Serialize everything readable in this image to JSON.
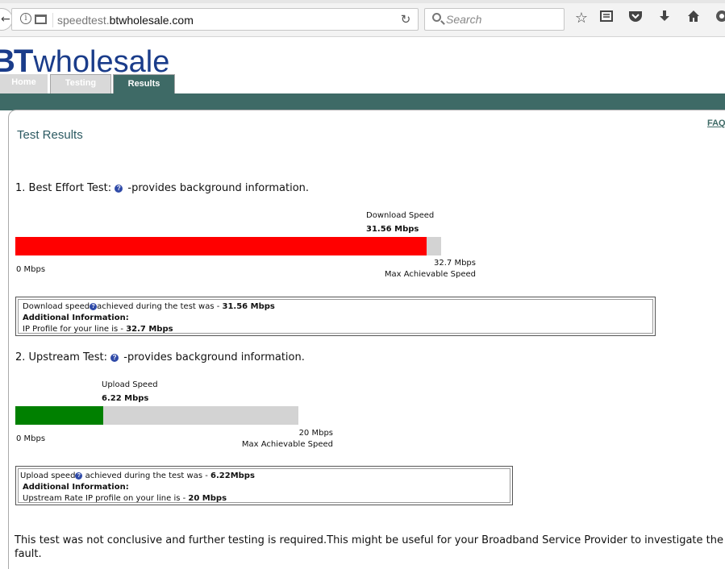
{
  "browser": {
    "url_prefix": "speedtest.",
    "url_domain": "btwholesale.com",
    "search_placeholder": "Search",
    "icons": [
      "back-icon",
      "info-icon",
      "page-icon",
      "reload-icon",
      "search-icon",
      "star-icon",
      "reading-list-icon",
      "pocket-icon",
      "download-icon",
      "home-icon",
      "addon-icon"
    ]
  },
  "header": {
    "logo_bt": "BT",
    "logo_wholesale": "wholesale",
    "tabs": [
      "Home",
      "Testing",
      "Results"
    ],
    "active_tab": "Results",
    "faq_label": "FAQ"
  },
  "page": {
    "title": "Test Results"
  },
  "download": {
    "heading_prefix": "1. Best Effort Test:",
    "heading_suffix": "-provides background information.",
    "bar_label": "Download Speed",
    "value_label": "31.56 Mbps",
    "min_label": "0 Mbps",
    "max_label": "32.7 Mbps",
    "max_caption": "Max Achievable Speed",
    "fill_fraction": 0.965,
    "fill_color": "#ff0000",
    "info": {
      "line1_a": "Download speed",
      "line1_b": "achieved during the test was - ",
      "line1_value": "31.56 Mbps",
      "line2": "Additional Information:",
      "line3_a": "IP Profile for your line is - ",
      "line3_value": "32.7 Mbps"
    }
  },
  "upload": {
    "heading_prefix": "2. Upstream Test:",
    "heading_suffix": "-provides background information.",
    "bar_label": "Upload Speed",
    "value_label": "6.22 Mbps",
    "min_label": "0 Mbps",
    "max_label": "20 Mbps",
    "max_caption": "Max Achievable Speed",
    "fill_fraction": 0.311,
    "fill_color": "#008000",
    "info": {
      "line1_a": "Upload speed",
      "line1_b": " achieved during the test was - ",
      "line1_value": "6.22Mbps",
      "line2": "Additional Information:",
      "line3_a": "Upstream Rate IP profile on your line is - ",
      "line3_value": "20 Mbps"
    }
  },
  "conclusion": "This test was not conclusive and further testing is required.This might be useful for your Broadband Service Provider to investigate the fault.",
  "colors": {
    "brand_blue": "#1a3c8a",
    "teal": "#3e6a66",
    "track_grey": "#d3d3d3"
  }
}
